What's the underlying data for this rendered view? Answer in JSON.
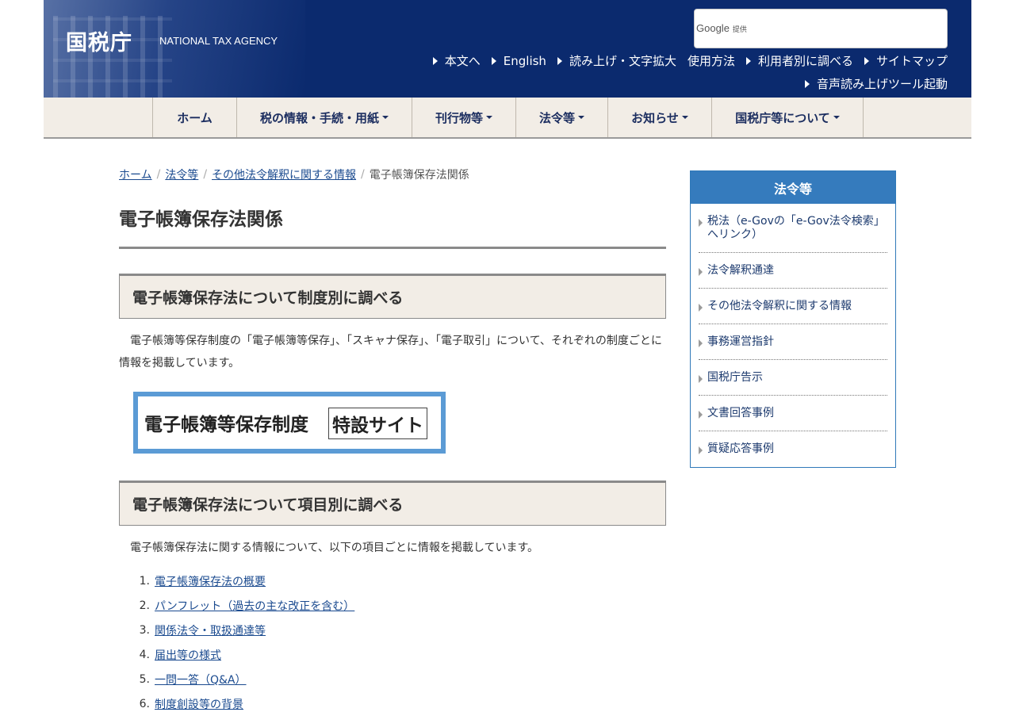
{
  "header": {
    "title": "国税庁",
    "subtitle": "NATIONAL TAX AGENCY",
    "search": {
      "brand": "Google",
      "provided": "提供"
    },
    "util_row1": [
      "本文へ",
      "English",
      "読み上げ・文字拡大",
      "使用方法",
      "利用者別に調べる",
      "サイトマップ"
    ],
    "util_row2": [
      "音声読み上げツール起動"
    ]
  },
  "nav": [
    "ホーム",
    "税の情報・手続・用紙",
    "刊行物等",
    "法令等",
    "お知らせ",
    "国税庁等について"
  ],
  "breadcrumb": [
    "ホーム",
    "法令等",
    "その他法令解釈に関する情報",
    "電子帳簿保存法関係"
  ],
  "page_title": "電子帳簿保存法関係",
  "section1": {
    "heading": "電子帳簿保存法について制度別に調べる",
    "text": "電子帳簿等保存制度の「電子帳簿等保存」、「スキャナ保存」、「電子取引」について、それぞれの制度ごとに情報を掲載しています。",
    "banner_text": "電子帳簿等保存制度",
    "banner_box": "特設サイト"
  },
  "section2": {
    "heading": "電子帳簿保存法について項目別に調べる",
    "text": "電子帳簿保存法に関する情報について、以下の項目ごとに情報を掲載しています。",
    "items": [
      {
        "num": "1.",
        "label": "電子帳簿保存法の概要"
      },
      {
        "num": "2.",
        "label": "パンフレット（過去の主な改正を含む）"
      },
      {
        "num": "3.",
        "label": "関係法令・取扱通達等"
      },
      {
        "num": "4.",
        "label": "届出等の様式"
      },
      {
        "num": "5.",
        "label": "一問一答（Q&A）"
      },
      {
        "num": "6.",
        "label": "制度創設等の背景"
      }
    ]
  },
  "sidebar": {
    "title": "法令等",
    "items": [
      "税法（e-Govの「e-Gov法令検索」へリンク）",
      "法令解釈通達",
      "その他法令解釈に関する情報",
      "事務運営指針",
      "国税庁告示",
      "文書回答事例",
      "質疑応答事例"
    ]
  },
  "colors": {
    "header_bg": "#0b2a6e",
    "nav_bg": "#f2ede6",
    "link": "#1a4a8f",
    "sidebar_head": "#357bbd",
    "banner_border": "#5b9bd5"
  }
}
